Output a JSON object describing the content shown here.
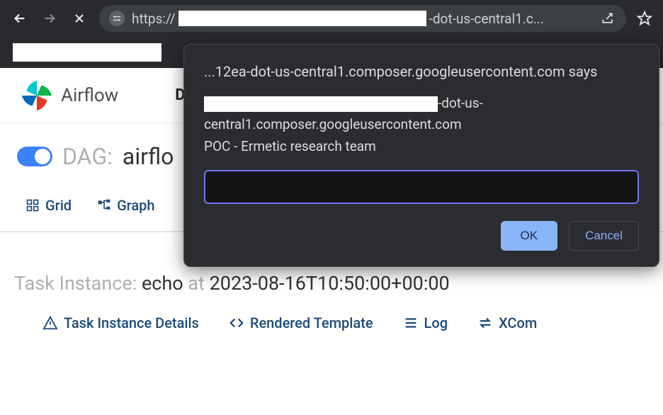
{
  "browser": {
    "url_prefix": "https://",
    "url_suffix": "-dot-us-central1.c..."
  },
  "airflow": {
    "brand": "Airflow",
    "nav_partial": "D"
  },
  "dag": {
    "label": "DAG:",
    "name_partial": "airflo"
  },
  "tabs": {
    "grid": "Grid",
    "graph": "Graph"
  },
  "task": {
    "label_prefix": "Task Instance:",
    "name": "echo",
    "at": "at",
    "timestamp": "2023-08-16T10:50:00+00:00"
  },
  "task_tabs": {
    "details": "Task Instance Details",
    "rendered": "Rendered Template",
    "log": "Log",
    "xcom": "XCom"
  },
  "dialog": {
    "origin": "...12ea-dot-us-central1.composer.googleusercontent.com says",
    "msg_line1_suffix": "-dot-us-",
    "msg_line2": "central1.composer.googleusercontent.com",
    "msg_line3": "POC - Ermetic research team",
    "ok": "OK",
    "cancel": "Cancel"
  }
}
